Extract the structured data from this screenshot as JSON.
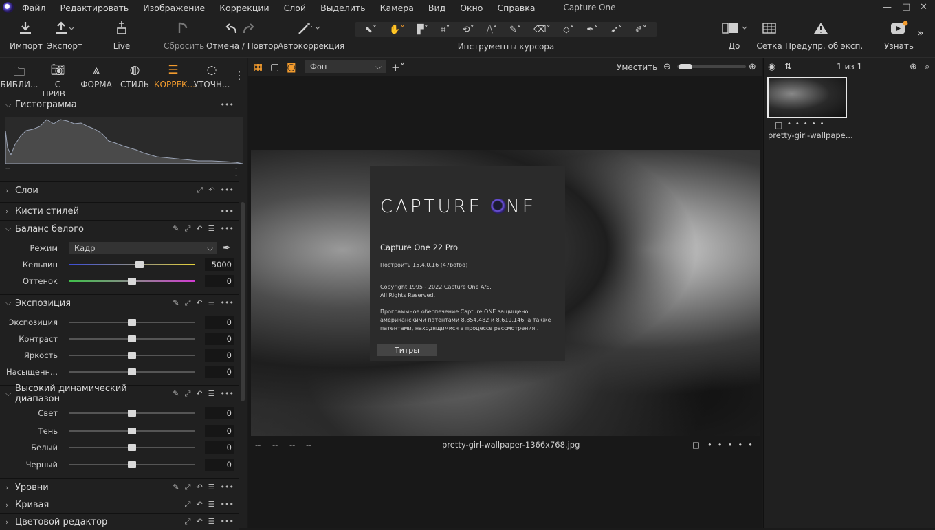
{
  "menubar": {
    "items": [
      "Файл",
      "Редактировать",
      "Изображение",
      "Коррекции",
      "Слой",
      "Выделить",
      "Камера",
      "Вид",
      "Окно",
      "Справка"
    ],
    "app_title": "Capture One",
    "win_controls": [
      "—",
      "□",
      "✕"
    ]
  },
  "toolbar": {
    "import": "Импорт",
    "export": "Экспорт",
    "live": "Live",
    "reset": "Сбросить",
    "undo_redo": "Отмена / Повтор",
    "autocorrect": "Автокоррекция",
    "cursor_tools": "Инструменты курсора",
    "before": "До",
    "grid": "Сетка",
    "exposure_warning": "Предупр. об эксп.",
    "learn": "Узнать"
  },
  "left_tabs": [
    {
      "label": "БИБЛИ...",
      "icon": "folder-icon"
    },
    {
      "label": "С ПРИВ...",
      "icon": "camera-icon"
    },
    {
      "label": "ФОРМА",
      "icon": "lens-icon"
    },
    {
      "label": "СТИЛЬ",
      "icon": "palette-icon"
    },
    {
      "label": "КОРРЕК...",
      "icon": "sliders-icon"
    },
    {
      "label": "УТОЧН...",
      "icon": "details-icon"
    }
  ],
  "histogram": {
    "title": "Гистограмма",
    "left_label": "--",
    "right_label": "--"
  },
  "sections": {
    "layers": "Слои",
    "style_brushes": "Кисти стилей",
    "white_balance": "Баланс белого",
    "exposure": "Экспозиция",
    "hdr": "Высокий динамический диапазон",
    "levels": "Уровни",
    "curve": "Кривая",
    "color_editor": "Цветовой редактор"
  },
  "white_balance": {
    "mode_label": "Режим",
    "mode_value": "Кадр",
    "kelvin_label": "Кельвин",
    "kelvin_value": "5000",
    "tint_label": "Оттенок",
    "tint_value": "0"
  },
  "exposure": {
    "rows": [
      {
        "label": "Экспозиция",
        "value": "0"
      },
      {
        "label": "Контраст",
        "value": "0"
      },
      {
        "label": "Яркость",
        "value": "0"
      },
      {
        "label": "Насыщенн...",
        "value": "0"
      }
    ]
  },
  "hdr": {
    "rows": [
      {
        "label": "Свет",
        "value": "0"
      },
      {
        "label": "Тень",
        "value": "0"
      },
      {
        "label": "Белый",
        "value": "0"
      },
      {
        "label": "Черный",
        "value": "0"
      }
    ]
  },
  "viewer": {
    "background_select": "Фон",
    "fit_label": "Уместить",
    "filename": "pretty-girl-wallpaper-1366x768.jpg",
    "meta_placeholders": [
      "--",
      "--",
      "--",
      "--"
    ]
  },
  "about": {
    "brand_left": "CAPTURE",
    "brand_right": "NE",
    "version": "Capture One 22 Pro",
    "build": "Построить 15.4.0.16 (47bdfbd)",
    "copyright_1": "Copyright 1995 - 2022 Capture One A/S.",
    "copyright_2": "All Rights Reserved.",
    "patent_1": "Программное обеспечение Capture ONE защищено",
    "patent_2": "американскими патентами   8.854.482 и 8.619.146, а также",
    "patent_3": "патентами, находящимися в процессе рассмотрения .",
    "credits_button": "Титры"
  },
  "browser": {
    "counter": "1 из 1",
    "thumb_name": "pretty-girl-wallpape..."
  },
  "colors": {
    "accent": "#f29b2e",
    "bg": "#202020",
    "viewer_bg": "#181818"
  }
}
